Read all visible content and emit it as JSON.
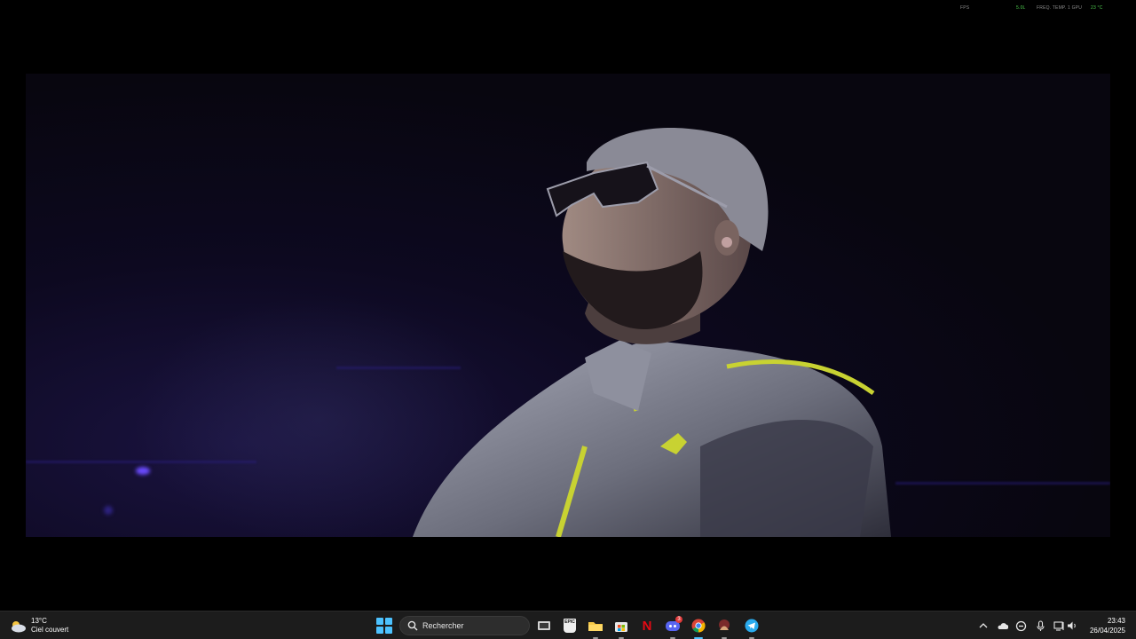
{
  "overlay": {
    "items": [
      {
        "label": "FPS",
        "value": ""
      },
      {
        "label": "",
        "value": "5.0L"
      },
      {
        "label": "FREQ. TEMP. 1 GPU",
        "value": ""
      },
      {
        "label": "",
        "value": "23 °C"
      }
    ]
  },
  "weather": {
    "temperature": "13°C",
    "condition": "Ciel couvert"
  },
  "search": {
    "placeholder": "Rechercher"
  },
  "taskbar": {
    "apps": [
      {
        "name": "task-view",
        "icon": "task-view-icon"
      },
      {
        "name": "epic-games",
        "icon": "epic-games-icon",
        "label": "EPIC"
      },
      {
        "name": "file-explorer",
        "icon": "folder-icon"
      },
      {
        "name": "microsoft-store",
        "icon": "store-icon"
      },
      {
        "name": "netflix",
        "icon": "netflix-icon",
        "label": "N"
      },
      {
        "name": "discord",
        "icon": "discord-icon",
        "badge": "3"
      },
      {
        "name": "chrome",
        "icon": "chrome-icon"
      },
      {
        "name": "game-app",
        "icon": "game-icon"
      },
      {
        "name": "telegram",
        "icon": "telegram-icon"
      }
    ]
  },
  "tray": {
    "icons": [
      "chevron-up-icon",
      "onedrive-icon",
      "vpn-icon",
      "microphone-icon",
      "network-icon",
      "speaker-icon"
    ]
  },
  "clock": {
    "time": "23:43",
    "date": "26/04/2025"
  },
  "colors": {
    "accent": "#4cc2ff",
    "taskbar": "#1c1c1c",
    "overlay_green": "#4ecb4e"
  }
}
